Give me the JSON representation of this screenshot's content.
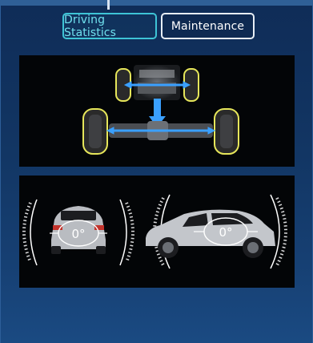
{
  "tabs": [
    {
      "label": "Driving Statistics",
      "active": true
    },
    {
      "label": "Maintenance",
      "active": false
    }
  ],
  "drivetrain": {
    "image": "awd-drivetrain-diagram",
    "highlight_color": "#e6e65a",
    "flow_color": "#3aa0ff"
  },
  "attitude": {
    "roll_value": "0°",
    "pitch_value": "0°",
    "gauge_color": "#ffffff"
  },
  "colors": {
    "accent": "#3ec4d6",
    "background": "#123664"
  }
}
